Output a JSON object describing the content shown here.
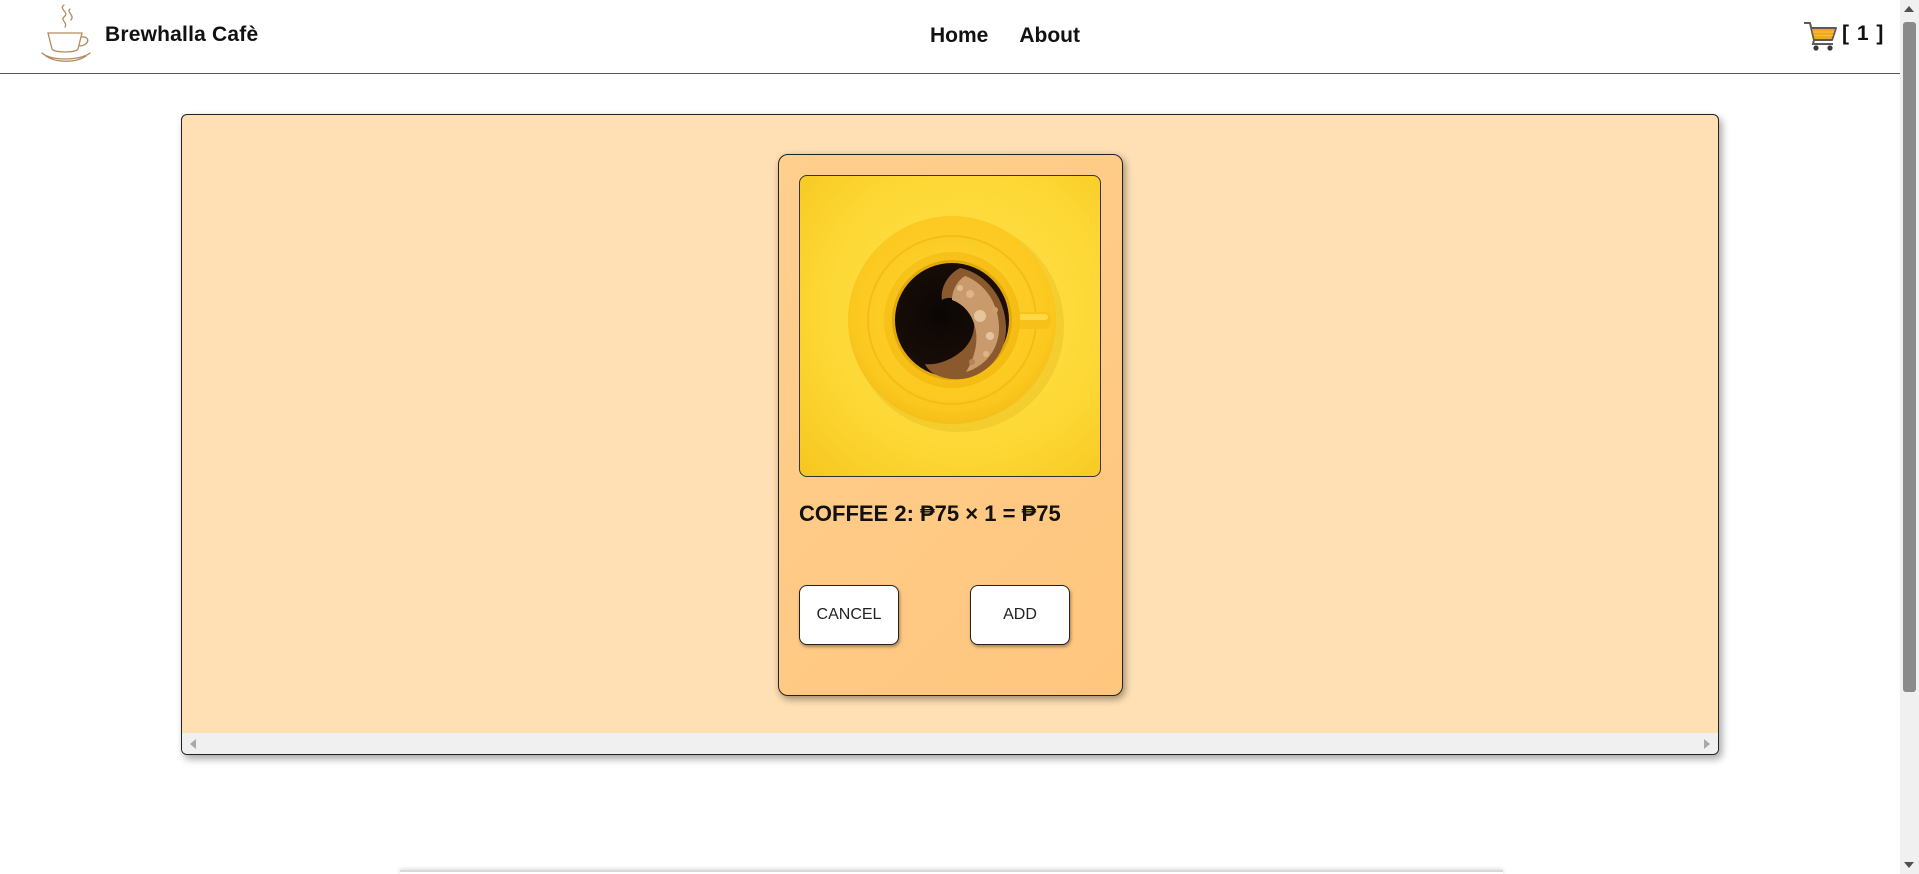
{
  "header": {
    "brand": "Brewhalla Cafè",
    "nav": [
      {
        "label": "Home"
      },
      {
        "label": "About"
      }
    ],
    "cart_count": "[ 1 ]"
  },
  "card": {
    "title": "COFFEE 2: ₱75 × 1 = ₱75",
    "image": "coffee-cup-on-yellow-background",
    "cancel_label": "CANCEL",
    "add_label": "ADD"
  },
  "colors": {
    "panel_background": "#ffe0b4",
    "card_background": "#ffc67e",
    "image_background": "#fdd835"
  }
}
